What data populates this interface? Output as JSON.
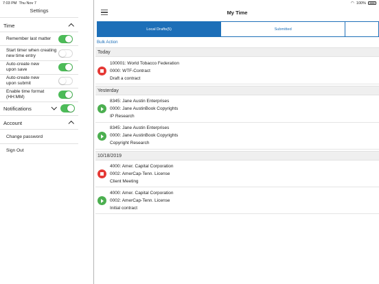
{
  "status_bar": {
    "time": "7:03 PM",
    "date": "Thu Nov 7",
    "battery": "100%"
  },
  "sidebar": {
    "title": "Settings",
    "sections": [
      {
        "label": "Time"
      },
      {
        "label": "Notifications"
      },
      {
        "label": "Account"
      }
    ],
    "time_settings": [
      {
        "label": "Remember last matter",
        "enabled": true
      },
      {
        "label": "Start timer when creating new time entry",
        "enabled": false
      },
      {
        "label": "Auto-create new upon save",
        "enabled": true
      },
      {
        "label": "Auto-create new upon submit",
        "enabled": false
      },
      {
        "label": "Enable time format (HH:MM)",
        "enabled": true
      }
    ],
    "notifications_enabled": true,
    "account_links": [
      "Change password",
      "Sign Out"
    ]
  },
  "main": {
    "title": "My Time",
    "tabs": [
      {
        "label": "Local Drafts(5)",
        "active": true
      },
      {
        "label": "Submitted",
        "active": false
      },
      {
        "label": "",
        "active": false
      }
    ],
    "bulk_action": "Bulk Action",
    "groups": [
      {
        "header": "Today",
        "entries": [
          {
            "state": "stop",
            "client": "100001: World  Tobacco Federation",
            "matter": "0000: WTF-Contract",
            "description": "Draft a contract"
          }
        ]
      },
      {
        "header": "Yesterday",
        "entries": [
          {
            "state": "play",
            "client": "8345: Jane Austin Enterprises",
            "matter": "0000: Jane AustinBook Copyrights",
            "description": "IP Research"
          },
          {
            "state": "play",
            "client": "8345: Jane Austin Enterprises",
            "matter": "0000: Jane AustinBook Copyrights",
            "description": "Copyright Research"
          }
        ]
      },
      {
        "header": "10/18/2019",
        "entries": [
          {
            "state": "stop",
            "client": "4000: Amer. Capital Corporation",
            "matter": "0002: AmerCap-Tenn. License",
            "description": "Client Meeting"
          },
          {
            "state": "play",
            "client": "4000: Amer. Capital Corporation",
            "matter": "0002: AmerCap-Tenn. License",
            "description": "Initial contract"
          }
        ]
      }
    ]
  },
  "colors": {
    "accent": "#1d6fb8",
    "toggle_on": "#4cbb58",
    "stop": "#e53935",
    "play": "#4caf50"
  }
}
